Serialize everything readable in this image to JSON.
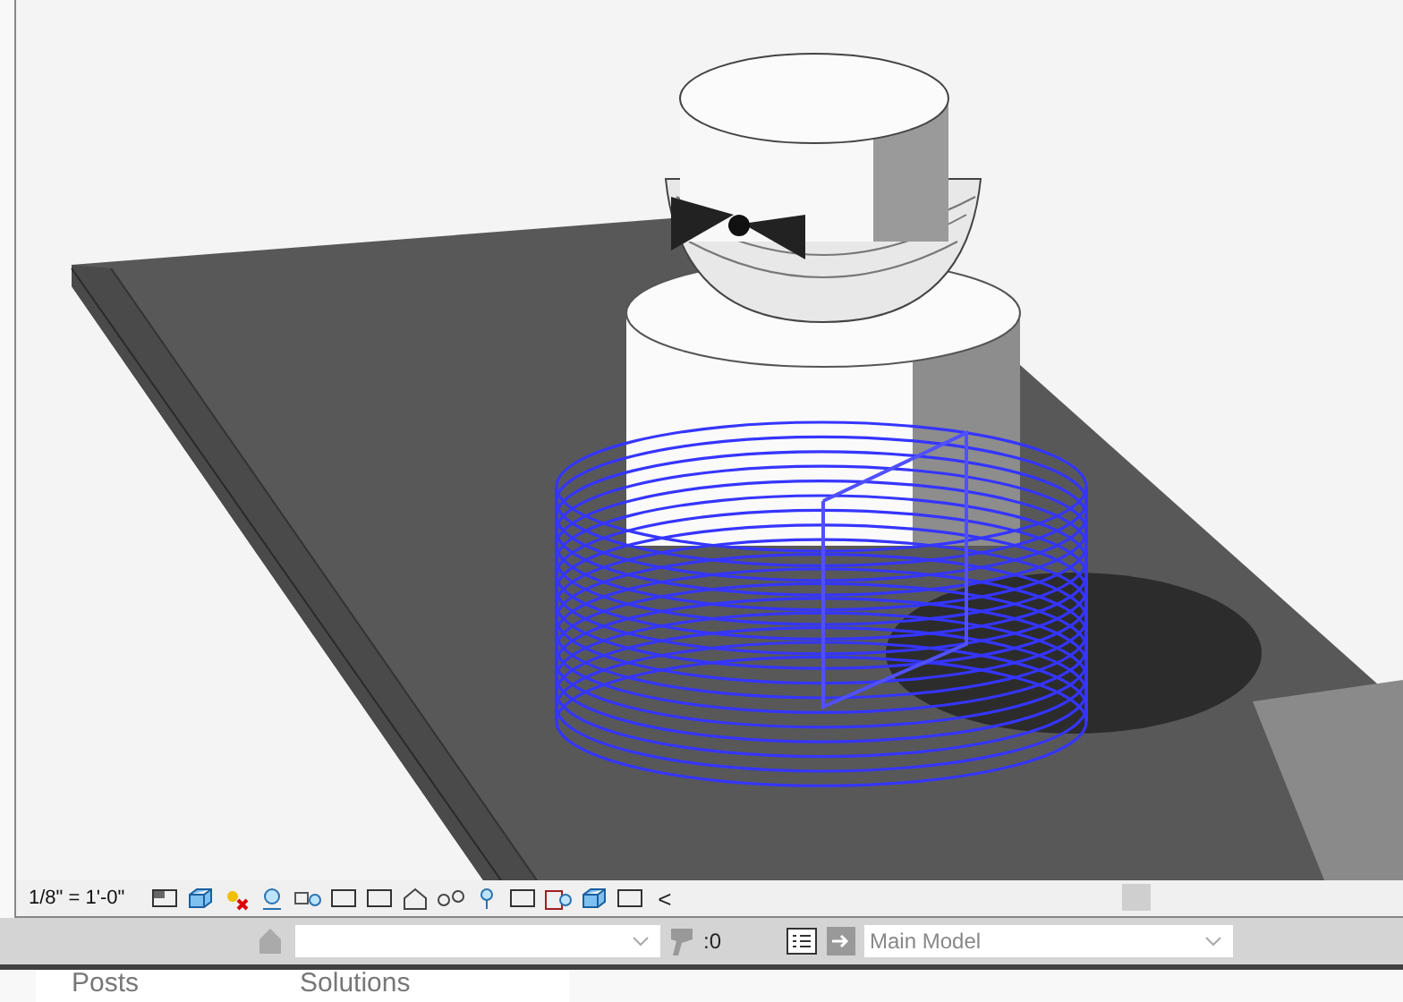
{
  "view_control_bar": {
    "scale": "1/8\" = 1'-0\"",
    "collapse_glyph": "<"
  },
  "status_bar": {
    "filter_count": ":0",
    "design_option_dropdown": {
      "value": "Main Model"
    }
  },
  "page_links": [
    "Posts",
    "Solutions"
  ]
}
